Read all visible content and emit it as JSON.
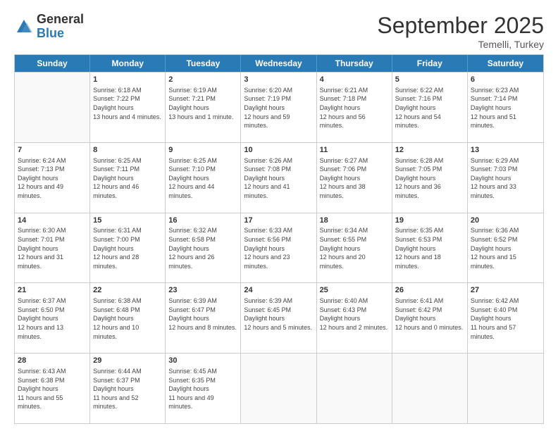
{
  "logo": {
    "general": "General",
    "blue": "Blue"
  },
  "header": {
    "month": "September 2025",
    "location": "Temelli, Turkey"
  },
  "weekdays": [
    "Sunday",
    "Monday",
    "Tuesday",
    "Wednesday",
    "Thursday",
    "Friday",
    "Saturday"
  ],
  "weeks": [
    [
      {
        "day": null
      },
      {
        "day": "1",
        "sunrise": "6:18 AM",
        "sunset": "7:22 PM",
        "daylight": "13 hours and 4 minutes."
      },
      {
        "day": "2",
        "sunrise": "6:19 AM",
        "sunset": "7:21 PM",
        "daylight": "13 hours and 1 minute."
      },
      {
        "day": "3",
        "sunrise": "6:20 AM",
        "sunset": "7:19 PM",
        "daylight": "12 hours and 59 minutes."
      },
      {
        "day": "4",
        "sunrise": "6:21 AM",
        "sunset": "7:18 PM",
        "daylight": "12 hours and 56 minutes."
      },
      {
        "day": "5",
        "sunrise": "6:22 AM",
        "sunset": "7:16 PM",
        "daylight": "12 hours and 54 minutes."
      },
      {
        "day": "6",
        "sunrise": "6:23 AM",
        "sunset": "7:14 PM",
        "daylight": "12 hours and 51 minutes."
      }
    ],
    [
      {
        "day": "7",
        "sunrise": "6:24 AM",
        "sunset": "7:13 PM",
        "daylight": "12 hours and 49 minutes."
      },
      {
        "day": "8",
        "sunrise": "6:25 AM",
        "sunset": "7:11 PM",
        "daylight": "12 hours and 46 minutes."
      },
      {
        "day": "9",
        "sunrise": "6:25 AM",
        "sunset": "7:10 PM",
        "daylight": "12 hours and 44 minutes."
      },
      {
        "day": "10",
        "sunrise": "6:26 AM",
        "sunset": "7:08 PM",
        "daylight": "12 hours and 41 minutes."
      },
      {
        "day": "11",
        "sunrise": "6:27 AM",
        "sunset": "7:06 PM",
        "daylight": "12 hours and 38 minutes."
      },
      {
        "day": "12",
        "sunrise": "6:28 AM",
        "sunset": "7:05 PM",
        "daylight": "12 hours and 36 minutes."
      },
      {
        "day": "13",
        "sunrise": "6:29 AM",
        "sunset": "7:03 PM",
        "daylight": "12 hours and 33 minutes."
      }
    ],
    [
      {
        "day": "14",
        "sunrise": "6:30 AM",
        "sunset": "7:01 PM",
        "daylight": "12 hours and 31 minutes."
      },
      {
        "day": "15",
        "sunrise": "6:31 AM",
        "sunset": "7:00 PM",
        "daylight": "12 hours and 28 minutes."
      },
      {
        "day": "16",
        "sunrise": "6:32 AM",
        "sunset": "6:58 PM",
        "daylight": "12 hours and 26 minutes."
      },
      {
        "day": "17",
        "sunrise": "6:33 AM",
        "sunset": "6:56 PM",
        "daylight": "12 hours and 23 minutes."
      },
      {
        "day": "18",
        "sunrise": "6:34 AM",
        "sunset": "6:55 PM",
        "daylight": "12 hours and 20 minutes."
      },
      {
        "day": "19",
        "sunrise": "6:35 AM",
        "sunset": "6:53 PM",
        "daylight": "12 hours and 18 minutes."
      },
      {
        "day": "20",
        "sunrise": "6:36 AM",
        "sunset": "6:52 PM",
        "daylight": "12 hours and 15 minutes."
      }
    ],
    [
      {
        "day": "21",
        "sunrise": "6:37 AM",
        "sunset": "6:50 PM",
        "daylight": "12 hours and 13 minutes."
      },
      {
        "day": "22",
        "sunrise": "6:38 AM",
        "sunset": "6:48 PM",
        "daylight": "12 hours and 10 minutes."
      },
      {
        "day": "23",
        "sunrise": "6:39 AM",
        "sunset": "6:47 PM",
        "daylight": "12 hours and 8 minutes."
      },
      {
        "day": "24",
        "sunrise": "6:39 AM",
        "sunset": "6:45 PM",
        "daylight": "12 hours and 5 minutes."
      },
      {
        "day": "25",
        "sunrise": "6:40 AM",
        "sunset": "6:43 PM",
        "daylight": "12 hours and 2 minutes."
      },
      {
        "day": "26",
        "sunrise": "6:41 AM",
        "sunset": "6:42 PM",
        "daylight": "12 hours and 0 minutes."
      },
      {
        "day": "27",
        "sunrise": "6:42 AM",
        "sunset": "6:40 PM",
        "daylight": "11 hours and 57 minutes."
      }
    ],
    [
      {
        "day": "28",
        "sunrise": "6:43 AM",
        "sunset": "6:38 PM",
        "daylight": "11 hours and 55 minutes."
      },
      {
        "day": "29",
        "sunrise": "6:44 AM",
        "sunset": "6:37 PM",
        "daylight": "11 hours and 52 minutes."
      },
      {
        "day": "30",
        "sunrise": "6:45 AM",
        "sunset": "6:35 PM",
        "daylight": "11 hours and 49 minutes."
      },
      {
        "day": null
      },
      {
        "day": null
      },
      {
        "day": null
      },
      {
        "day": null
      }
    ]
  ]
}
